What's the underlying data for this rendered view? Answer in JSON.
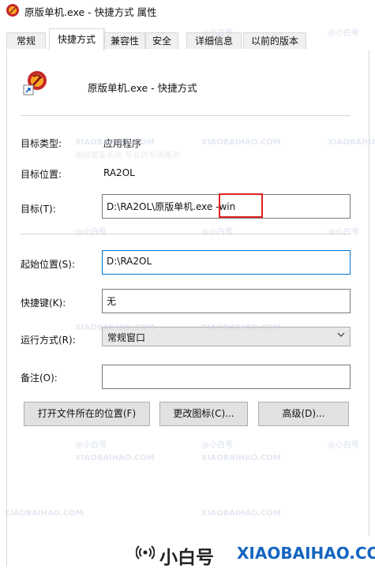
{
  "window": {
    "title": "原版单机.exe - 快捷方式 属性"
  },
  "tabs": [
    {
      "label": "常规",
      "active": false
    },
    {
      "label": "快捷方式",
      "active": true
    },
    {
      "label": "兼容性",
      "active": false
    },
    {
      "label": "安全",
      "active": false
    },
    {
      "label": "详细信息",
      "active": false
    },
    {
      "label": "以前的版本",
      "active": false
    }
  ],
  "shortcut": {
    "name": "原版单机.exe - 快捷方式"
  },
  "fields": {
    "target_type_label": "目标类型:",
    "target_type_value": "应用程序",
    "target_location_label": "目标位置:",
    "target_location_value": "RA2OL",
    "target_label": "目标(T):",
    "target_value": "D:\\RA2OL\\原版单机.exe -win",
    "start_in_label": "起始位置(S):",
    "start_in_value": "D:\\RA2OL",
    "hotkey_label": "快捷键(K):",
    "hotkey_value": "无",
    "run_label": "运行方式(R):",
    "run_value": "常规窗口",
    "comment_label": "备注(O):",
    "comment_value": ""
  },
  "buttons": {
    "open_location": "打开文件所在的位置(F)",
    "change_icon": "更改图标(C)...",
    "advanced": "高级(D)..."
  },
  "watermark": {
    "logo_text": "@小白号",
    "site_text": "XIAOBAIHAO.COM",
    "small_text": "电脑重装系统 专业的系统服务"
  },
  "banner": {
    "logo_text": "小白号",
    "site_text": "XIAOBAIHAO.COM"
  },
  "colors": {
    "highlight": "#e02020",
    "focus_border": "#0078d7",
    "banner_site": "#1565c0"
  }
}
